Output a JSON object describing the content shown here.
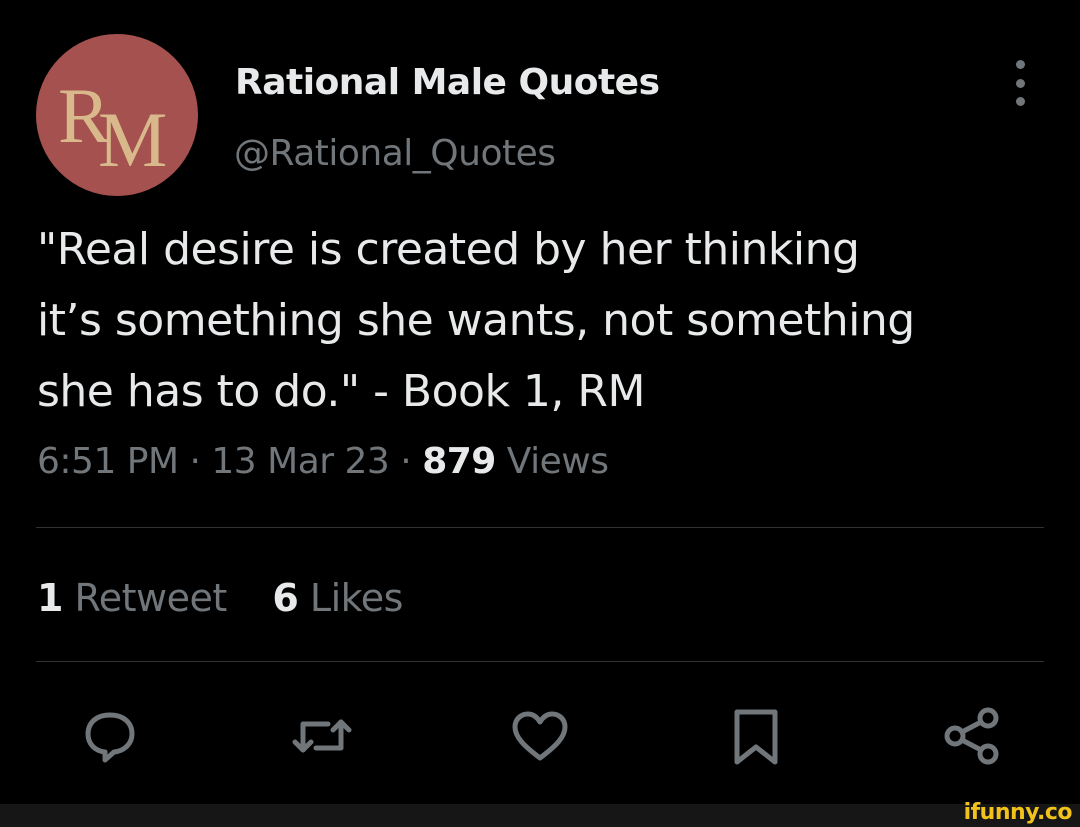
{
  "account": {
    "display_name": "Rational Male Quotes",
    "handle": "@Rational_Quotes",
    "avatar_initials": "RM",
    "avatar_color": "#a4514f"
  },
  "tweet": {
    "text": "\"Real desire is created by her thinking\nit’s something she wants, not something\nshe has to do.\" - Book 1, RM",
    "time": "6:51 PM",
    "separator": " · ",
    "date": "13 Mar 23",
    "views_count": "879",
    "views_label": "Views"
  },
  "stats": {
    "retweets_count": "1",
    "retweets_label": "Retweet",
    "likes_count": "6",
    "likes_label": "Likes"
  },
  "actions": [
    {
      "icon": "reply-icon"
    },
    {
      "icon": "retweet-icon"
    },
    {
      "icon": "like-icon"
    },
    {
      "icon": "bookmark-icon"
    },
    {
      "icon": "share-icon"
    }
  ],
  "colors": {
    "background": "#000000",
    "text_primary": "#e7e9ea",
    "text_secondary": "#71767b",
    "divider": "#2f3336",
    "watermark": "#f2c21c"
  },
  "watermark": "ifunny.co"
}
